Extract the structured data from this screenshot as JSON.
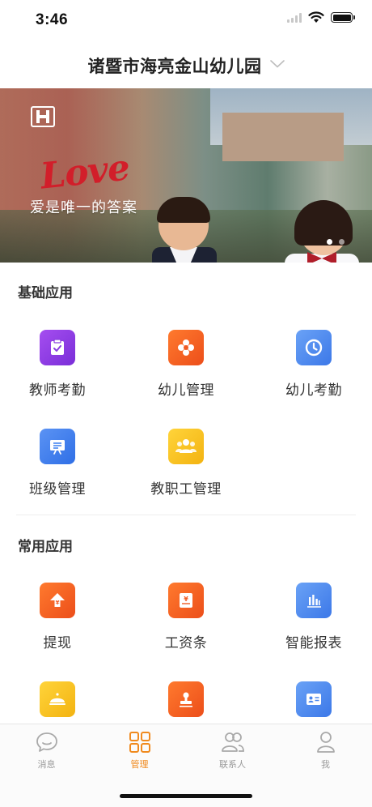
{
  "status_bar": {
    "time": "3:46"
  },
  "header": {
    "title": "诸暨市海亮金山幼儿园"
  },
  "banner": {
    "script_text": "Love",
    "caption": "爱是唯一的答案",
    "dots": 2,
    "active_dot": 0
  },
  "sections": [
    {
      "title": "基础应用",
      "apps": [
        {
          "label": "教师考勤",
          "icon": "clipboard-check-icon",
          "color": "#8a3ddf"
        },
        {
          "label": "幼儿管理",
          "icon": "flower-icon",
          "color": "#f05a22"
        },
        {
          "label": "幼儿考勤",
          "icon": "clock-icon",
          "color": "#4a86ec"
        },
        {
          "label": "班级管理",
          "icon": "presentation-board-icon",
          "color": "#3a7ff0"
        },
        {
          "label": "教职工管理",
          "icon": "group-icon",
          "color": "#f6bf1e"
        }
      ]
    },
    {
      "title": "常用应用",
      "apps": [
        {
          "label": "提现",
          "icon": "upload-arrow-icon",
          "color": "#f15a22"
        },
        {
          "label": "工资条",
          "icon": "yen-scroll-icon",
          "color": "#f05a22"
        },
        {
          "label": "智能报表",
          "icon": "bar-chart-icon",
          "color": "#4a86ec"
        },
        {
          "label": "",
          "icon": "food-cloche-icon",
          "color": "#f6bf1e"
        },
        {
          "label": "",
          "icon": "stamp-icon",
          "color": "#f05a22"
        },
        {
          "label": "",
          "icon": "id-card-icon",
          "color": "#4a86ec"
        }
      ]
    }
  ],
  "tabbar": {
    "tabs": [
      {
        "label": "消息",
        "icon": "chat-bubble-icon",
        "active": false
      },
      {
        "label": "管理",
        "icon": "grid-icon",
        "active": true
      },
      {
        "label": "联系人",
        "icon": "contacts-icon",
        "active": false
      },
      {
        "label": "我",
        "icon": "person-icon",
        "active": false
      }
    ]
  },
  "colors": {
    "accent": "#f08a1e",
    "inactive_tab": "#9a9a9a"
  }
}
